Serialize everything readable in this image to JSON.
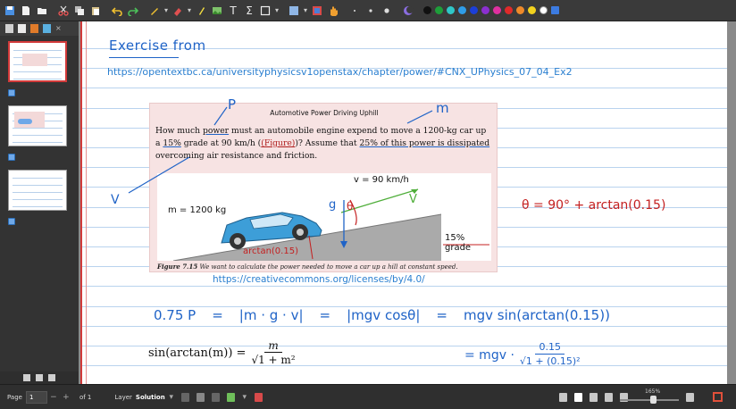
{
  "toolbar": {
    "tools": [
      "save-icon",
      "new-page-icon",
      "open-folder-icon",
      "cut-icon",
      "copy-icon",
      "paste-icon",
      "undo-icon",
      "redo-icon",
      "pen-icon",
      "eraser-icon",
      "highlighter-icon",
      "image-icon",
      "text-icon",
      "math-icon",
      "shape-icon",
      "select-icon",
      "insert-image-icon",
      "hand-icon",
      "moon-icon"
    ],
    "text_tool": "T",
    "math_tool": "Σ",
    "palette": [
      "#111111",
      "#1e9e3a",
      "#2fc7c7",
      "#2f9de8",
      "#1c3fd8",
      "#8b2fd0",
      "#e030a0",
      "#e02a2a",
      "#ee8a2a",
      "#f2d21e",
      "#ffffff",
      "#3c7be0"
    ]
  },
  "sidebar": {
    "pages": [
      {
        "selected": true,
        "checked": true
      },
      {
        "selected": false,
        "checked": true
      },
      {
        "selected": false,
        "checked": true
      }
    ]
  },
  "page": {
    "exercise_title": "Exercise from",
    "exercise_url": "https://opentextbc.ca/universityphysicsv1openstax/chapter/power/#CNX_UPhysics_07_04_Ex2",
    "figure": {
      "title": "Automotive Power Driving Uphill",
      "problem_part1": "How much ",
      "problem_power": "power",
      "problem_part2": " must an automobile engine expend to move a 1200-kg car up a ",
      "problem_grade": "15%",
      "problem_part3": " grade at 90 km/h (",
      "problem_figure_link": "(Figure)",
      "problem_part4": ")? Assume that ",
      "problem_dissipated": "25% of this power is dissipated",
      "problem_part5": " overcoming air resistance and friction.",
      "velocity_label": "v = 90 km/h",
      "mass_label": "m = 1200 kg",
      "grade_label": "15% grade",
      "caption_label": "Figure 7.15",
      "caption_text": " We want to calculate the power needed to move a car up a hill at constant speed."
    },
    "annotations": {
      "p_label": "P",
      "m_label": "m",
      "v_left": "V",
      "v_arrow": "V",
      "g_vec": "g",
      "theta": "θ",
      "arctan_label": "arctan(0.15)",
      "theta_eq": "θ = 90° + arctan(0.15)"
    },
    "license_url": "https://creativecommons.org/licenses/by/4.0/",
    "eq_power": "0.75 P",
    "eq_eq": "=",
    "eq_dot": "|m · g · v|",
    "eq_cos": "|mgv cosθ|",
    "eq_sin_arctan": "mgv sin(arctan(0.15))",
    "eq_sin_lhs": "sin(arctan(m)) =",
    "eq_sin_num": "m",
    "eq_sin_den": "√1 + m²",
    "eq_mgv_prefix": "= mgv ·",
    "eq_mgv_num": "0.15",
    "eq_mgv_den": "√1 + (0.15)²"
  },
  "statusbar": {
    "page_label": "Page",
    "page_value": "1",
    "of_label": "of 1",
    "layer_label": "Layer",
    "layer_value": "Solution",
    "zoom": "165%"
  }
}
